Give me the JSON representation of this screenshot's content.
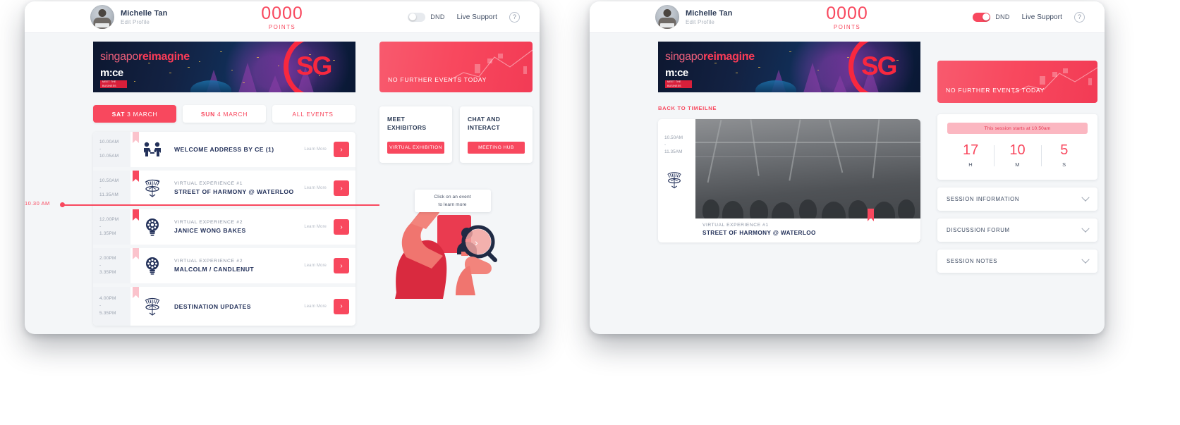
{
  "brand": {
    "accent": "#f8485e",
    "accent_soft": "#fbb7c1",
    "dark": "#23315a",
    "page_bg": "#f4f6f8"
  },
  "screen_a": {
    "topbar": {
      "user_name": "Michelle Tan",
      "edit_profile": "Edit Profile",
      "points_value": "0000",
      "points_label": "POINTS",
      "dnd_label": "DND",
      "dnd_on": false,
      "live_support": "Live Support",
      "help_icon": "?",
      "avatar_icon": "avatar"
    },
    "banner": {
      "line1_thin": "singapo",
      "line1_bold": "reimagine",
      "logo": "m:ce",
      "badge_line1": "MEET THE",
      "badge_line2": "BUSINESS",
      "sg_mark": "SG"
    },
    "tabs": [
      {
        "strong": "SAT",
        "light": "3 MARCH",
        "active": true
      },
      {
        "strong": "SUN",
        "light": "4 MARCH",
        "active": false
      },
      {
        "strong": "ALL EVENTS",
        "light": "",
        "active": false
      }
    ],
    "now_marker": {
      "label": "10.30 AM"
    },
    "events": [
      {
        "start": "10.00AM",
        "dash": "-",
        "end": "10.05AM",
        "subtitle": "",
        "title": "WELCOME ADDRESS BY CE (1)",
        "learn_more": "Learn More",
        "go": "›",
        "flag": "faded",
        "icon": "handshake-icon"
      },
      {
        "start": "10.50AM",
        "dash": "-",
        "end": "11.35AM",
        "subtitle": "VIRTUAL EXPERIENCE #1",
        "title": "STREET OF HARMONY @ WATERLOO",
        "learn_more": "Learn More",
        "go": "›",
        "flag": "solid",
        "icon": "supertree-icon"
      },
      {
        "start": "12.00PM",
        "dash": "-",
        "end": "1.35PM",
        "subtitle": "VIRTUAL EXPERIENCE #2",
        "title": "JANICE WONG BAKES",
        "learn_more": "Learn More",
        "go": "›",
        "flag": "solid",
        "icon": "bulb-icon"
      },
      {
        "start": "2.00PM",
        "dash": "-",
        "end": "3.35PM",
        "subtitle": "VIRTUAL EXPERIENCE #2",
        "title": "MALCOLM / CANDLENUT",
        "learn_more": "Learn More",
        "go": "›",
        "flag": "faded",
        "icon": "bulb-icon"
      },
      {
        "start": "4.00PM",
        "dash": "-",
        "end": "5.35PM",
        "subtitle": "",
        "title": "DESTINATION UPDATES",
        "learn_more": "Learn More",
        "go": "›",
        "flag": "faded",
        "icon": "supertree-icon"
      }
    ],
    "no_further": "NO FURTHER EVENTS TODAY",
    "cards": [
      {
        "title": "MEET\nEXHIBITORS",
        "title_l1": "MEET",
        "title_l2": "EXHIBITORS",
        "button": "VIRTUAL EXHIBITION"
      },
      {
        "title": "CHAT AND\nINTERACT",
        "title_l1": "CHAT AND",
        "title_l2": "INTERACT",
        "button": "MEETING HUB"
      }
    ],
    "illustration": {
      "tip_line1": "Click on an event",
      "tip_line2": "to learn more",
      "chevron": "›"
    }
  },
  "screen_b": {
    "topbar": {
      "user_name": "Michelle Tan",
      "edit_profile": "Edit Profile",
      "points_value": "0000",
      "points_label": "POINTS",
      "dnd_label": "DND",
      "dnd_on": true,
      "live_support": "Live Support",
      "help_icon": "?"
    },
    "banner": {
      "line1_thin": "singapo",
      "line1_bold": "reimagine",
      "logo": "m:ce",
      "badge_line1": "MEET THE",
      "badge_line2": "BUSINESS",
      "sg_mark": "SG"
    },
    "no_further": "NO FURTHER EVENTS TODAY",
    "back_link": "BACK TO TIMEILNE",
    "session": {
      "start": "10.50AM",
      "dash": "-",
      "end": "11.35AM",
      "icon": "supertree-icon",
      "subtitle": "VIRTUAL EXPERIENCE #1",
      "title": "STREET OF HARMONY @ WATERLOO"
    },
    "countdown": {
      "banner": "This session starts at 10.50am",
      "cells": [
        {
          "value": "17",
          "unit": "H"
        },
        {
          "value": "10",
          "unit": "M"
        },
        {
          "value": "5",
          "unit": "S"
        }
      ]
    },
    "accordions": [
      {
        "label": "SESSION INFORMATION",
        "icon": "chevron-down-icon"
      },
      {
        "label": "DISCUSSION FORUM",
        "icon": "chevron-down-icon"
      },
      {
        "label": "SESSION NOTES",
        "icon": "chevron-down-icon"
      }
    ]
  }
}
